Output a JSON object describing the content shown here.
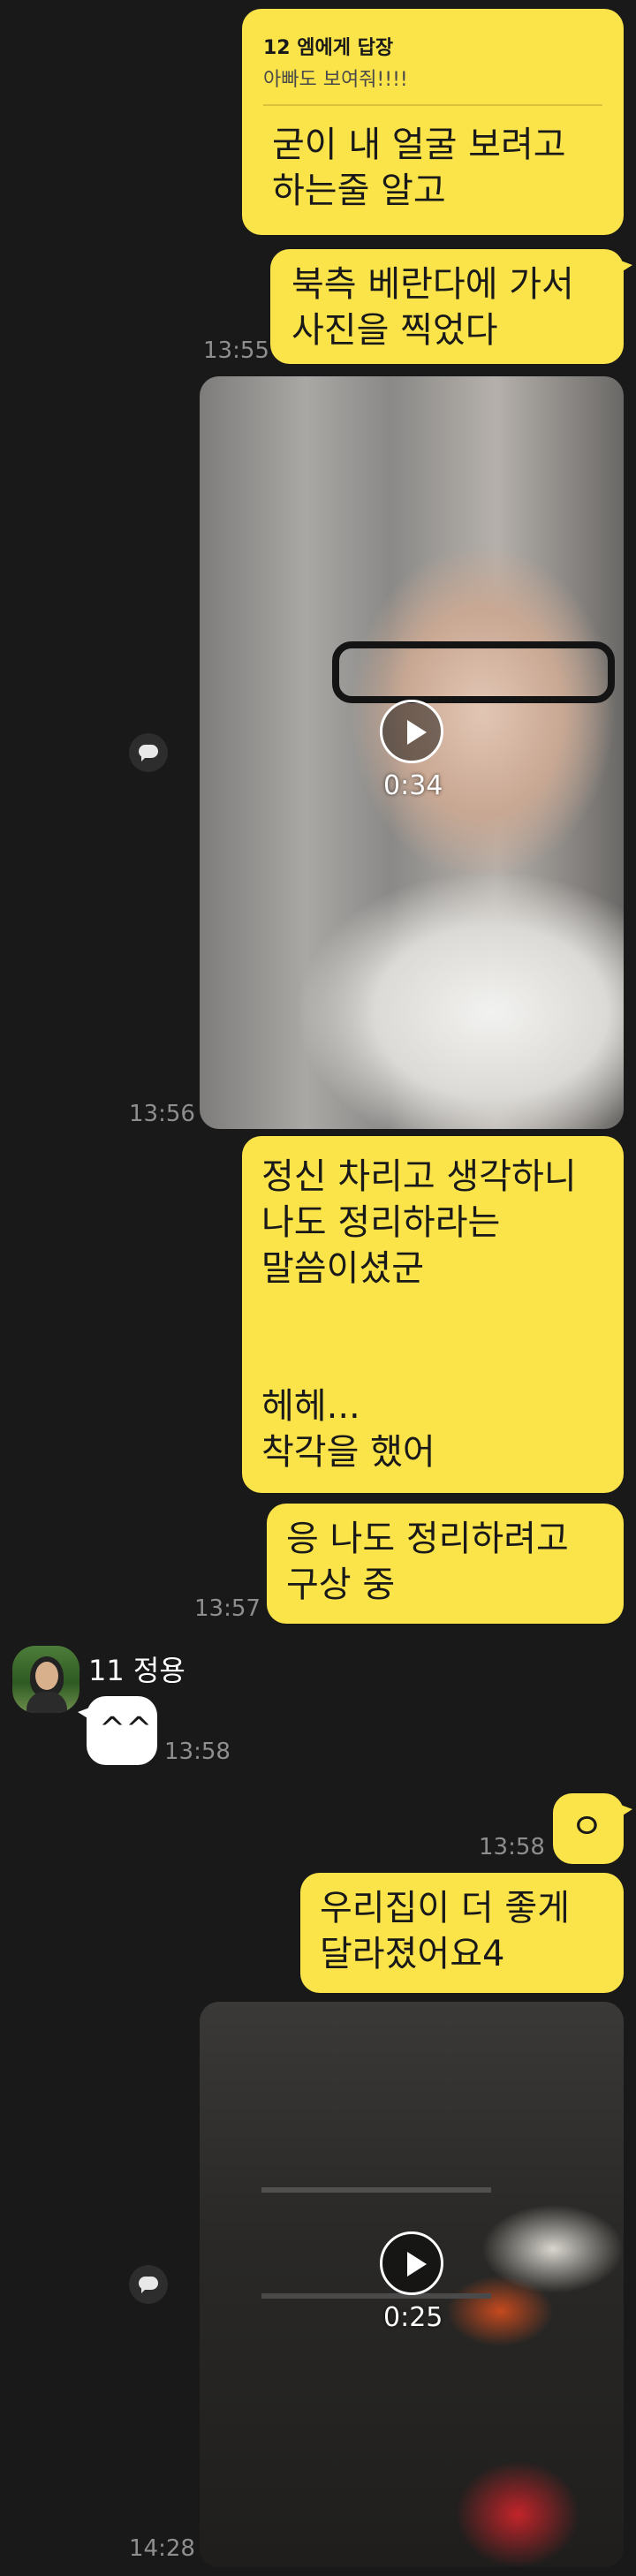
{
  "reply": {
    "target": "12 엠에게 답장",
    "quote": "아빠도 보여줘!!!!",
    "text": "굳이 내 얼굴 보려고\n하는줄 알고"
  },
  "messages": {
    "m1": "북측 베란다에 가서\n사진을 찍었다",
    "m1_time": "13:55",
    "video1_duration": "0:34",
    "video1_time": "13:56",
    "m2": "정신 차리고 생각하니\n나도 정리하라는\n말씀이셨군\n\n\n헤헤...\n착각을 했어",
    "m3": "응  나도 정리하려고\n구상 중",
    "m3_time": "13:57",
    "sender": "11 정용",
    "m4": "^^",
    "m4_time": "13:58",
    "m5": "ㅇ",
    "m5_time": "13:58",
    "m6": "우리집이 더 좋게\n달라졌어요4",
    "video2_duration": "0:25",
    "video2_time": "14:28"
  },
  "icons": {
    "play": "play-icon",
    "chat": "chat-bubble-icon"
  },
  "colors": {
    "background": "#191919",
    "my_bubble": "#fbe44a",
    "other_bubble": "#ffffff",
    "timestamp": "#8e8e8e"
  }
}
